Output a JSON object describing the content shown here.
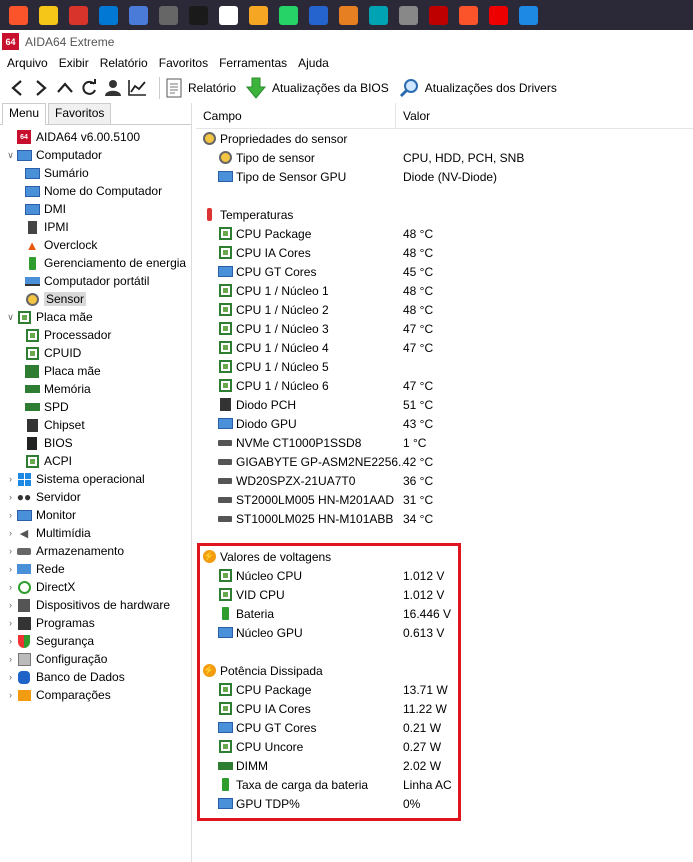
{
  "window": {
    "app_logo": "64",
    "title": "AIDA64 Extreme"
  },
  "menubar": [
    "Arquivo",
    "Exibir",
    "Relatório",
    "Favoritos",
    "Ferramentas",
    "Ajuda"
  ],
  "toolbar": {
    "report": "Relatório",
    "bios_updates": "Atualizações da BIOS",
    "driver_updates": "Atualizações dos Drivers"
  },
  "tabs": {
    "menu": "Menu",
    "favorites": "Favoritos"
  },
  "tree": [
    {
      "label": "AIDA64 v6.00.5100",
      "indent": 0,
      "exp": "",
      "icon": "aida-logo"
    },
    {
      "label": "Computador",
      "indent": 0,
      "exp": "v",
      "icon": "computer"
    },
    {
      "label": "Sumário",
      "indent": 1,
      "exp": "",
      "icon": "monitor"
    },
    {
      "label": "Nome do Computador",
      "indent": 1,
      "exp": "",
      "icon": "monitor"
    },
    {
      "label": "DMI",
      "indent": 1,
      "exp": "",
      "icon": "monitor"
    },
    {
      "label": "IPMI",
      "indent": 1,
      "exp": "",
      "icon": "server"
    },
    {
      "label": "Overclock",
      "indent": 1,
      "exp": "",
      "icon": "flame"
    },
    {
      "label": "Gerenciamento de energia",
      "indent": 1,
      "exp": "",
      "icon": "battery"
    },
    {
      "label": "Computador portátil",
      "indent": 1,
      "exp": "",
      "icon": "laptop"
    },
    {
      "label": "Sensor",
      "indent": 1,
      "exp": "",
      "icon": "gauge",
      "selected": true
    },
    {
      "label": "Placa mãe",
      "indent": 0,
      "exp": "v",
      "icon": "chip"
    },
    {
      "label": "Processador",
      "indent": 1,
      "exp": "",
      "icon": "chip"
    },
    {
      "label": "CPUID",
      "indent": 1,
      "exp": "",
      "icon": "chip"
    },
    {
      "label": "Placa mãe",
      "indent": 1,
      "exp": "",
      "icon": "board"
    },
    {
      "label": "Memória",
      "indent": 1,
      "exp": "",
      "icon": "ram"
    },
    {
      "label": "SPD",
      "indent": 1,
      "exp": "",
      "icon": "ram"
    },
    {
      "label": "Chipset",
      "indent": 1,
      "exp": "",
      "icon": "chipset"
    },
    {
      "label": "BIOS",
      "indent": 1,
      "exp": "",
      "icon": "bios"
    },
    {
      "label": "ACPI",
      "indent": 1,
      "exp": "",
      "icon": "chip"
    },
    {
      "label": "Sistema operacional",
      "indent": 0,
      "exp": ">",
      "icon": "windows"
    },
    {
      "label": "Servidor",
      "indent": 0,
      "exp": ">",
      "icon": "users"
    },
    {
      "label": "Monitor",
      "indent": 0,
      "exp": ">",
      "icon": "monitor"
    },
    {
      "label": "Multimídia",
      "indent": 0,
      "exp": ">",
      "icon": "speaker"
    },
    {
      "label": "Armazenamento",
      "indent": 0,
      "exp": ">",
      "icon": "storage"
    },
    {
      "label": "Rede",
      "indent": 0,
      "exp": ">",
      "icon": "network"
    },
    {
      "label": "DirectX",
      "indent": 0,
      "exp": ">",
      "icon": "directx"
    },
    {
      "label": "Dispositivos de hardware",
      "indent": 0,
      "exp": ">",
      "icon": "devices"
    },
    {
      "label": "Programas",
      "indent": 0,
      "exp": ">",
      "icon": "programs"
    },
    {
      "label": "Segurança",
      "indent": 0,
      "exp": ">",
      "icon": "shield"
    },
    {
      "label": "Configuração",
      "indent": 0,
      "exp": ">",
      "icon": "config"
    },
    {
      "label": "Banco de Dados",
      "indent": 0,
      "exp": ">",
      "icon": "database"
    },
    {
      "label": "Comparações",
      "indent": 0,
      "exp": ">",
      "icon": "compare"
    }
  ],
  "columns": {
    "field": "Campo",
    "value": "Valor"
  },
  "rows": [
    {
      "type": "group",
      "field": "Propriedades do sensor",
      "value": "",
      "icon": "gauge"
    },
    {
      "type": "item",
      "field": "Tipo de sensor",
      "value": "CPU, HDD, PCH, SNB",
      "icon": "gauge"
    },
    {
      "type": "item",
      "field": "Tipo de Sensor GPU",
      "value": "Diode  (NV-Diode)",
      "icon": "monitor"
    },
    {
      "type": "blank"
    },
    {
      "type": "group",
      "field": "Temperaturas",
      "value": "",
      "icon": "thermo"
    },
    {
      "type": "item",
      "field": "CPU Package",
      "value": "48 °C",
      "icon": "chip"
    },
    {
      "type": "item",
      "field": "CPU IA Cores",
      "value": "48 °C",
      "icon": "chip"
    },
    {
      "type": "item",
      "field": "CPU GT Cores",
      "value": "45 °C",
      "icon": "monitor"
    },
    {
      "type": "item",
      "field": "CPU 1 / Núcleo 1",
      "value": "48 °C",
      "icon": "chip"
    },
    {
      "type": "item",
      "field": "CPU 1 / Núcleo 2",
      "value": "48 °C",
      "icon": "chip"
    },
    {
      "type": "item",
      "field": "CPU 1 / Núcleo 3",
      "value": "47 °C",
      "icon": "chip"
    },
    {
      "type": "item",
      "field": "CPU 1 / Núcleo 4",
      "value": "47 °C",
      "icon": "chip"
    },
    {
      "type": "item",
      "field": "CPU 1 / Núcleo 5",
      "value": "",
      "icon": "chip"
    },
    {
      "type": "item",
      "field": "CPU 1 / Núcleo 6",
      "value": "47 °C",
      "icon": "chip"
    },
    {
      "type": "item",
      "field": "Diodo PCH",
      "value": "51 °C",
      "icon": "chipset"
    },
    {
      "type": "item",
      "field": "Diodo GPU",
      "value": "43 °C",
      "icon": "monitor"
    },
    {
      "type": "item",
      "field": "NVMe CT1000P1SSD8",
      "value": "1 °C",
      "icon": "disk"
    },
    {
      "type": "item",
      "field": "GIGABYTE GP-ASM2NE2256...",
      "value": "42 °C",
      "icon": "disk"
    },
    {
      "type": "item",
      "field": "WD20SPZX-21UA7T0",
      "value": "36 °C",
      "icon": "disk"
    },
    {
      "type": "item",
      "field": "ST2000LM005 HN-M201AAD",
      "value": "31 °C",
      "icon": "disk"
    },
    {
      "type": "item",
      "field": "ST1000LM025 HN-M101ABB",
      "value": "34 °C",
      "icon": "disk"
    },
    {
      "type": "blank"
    },
    {
      "type": "group",
      "field": "Valores de voltagens",
      "value": "",
      "icon": "bolt"
    },
    {
      "type": "item",
      "field": "Núcleo CPU",
      "value": "1.012 V",
      "icon": "chip"
    },
    {
      "type": "item",
      "field": "VID CPU",
      "value": "1.012 V",
      "icon": "chip"
    },
    {
      "type": "item",
      "field": "Bateria",
      "value": "16.446 V",
      "icon": "battery"
    },
    {
      "type": "item",
      "field": "Núcleo GPU",
      "value": "0.613 V",
      "icon": "monitor"
    },
    {
      "type": "blank"
    },
    {
      "type": "group",
      "field": "Potência Dissipada",
      "value": "",
      "icon": "bolt"
    },
    {
      "type": "item",
      "field": "CPU Package",
      "value": "13.71 W",
      "icon": "chip"
    },
    {
      "type": "item",
      "field": "CPU IA Cores",
      "value": "11.22 W",
      "icon": "chip"
    },
    {
      "type": "item",
      "field": "CPU GT Cores",
      "value": "0.21 W",
      "icon": "monitor"
    },
    {
      "type": "item",
      "field": "CPU Uncore",
      "value": "0.27 W",
      "icon": "chip"
    },
    {
      "type": "item",
      "field": "DIMM",
      "value": "2.02 W",
      "icon": "ram"
    },
    {
      "type": "item",
      "field": "Taxa de carga da bateria",
      "value": "Linha AC",
      "icon": "battery"
    },
    {
      "type": "item",
      "field": "GPU TDP%",
      "value": "0%",
      "icon": "monitor"
    }
  ],
  "taskbar_icons": [
    "brave",
    "file-explorer",
    "app-red",
    "microsoft-store",
    "app-circle",
    "calculator",
    "investing",
    "grammarly",
    "vlc",
    "whatsapp",
    "todo-check",
    "app-orange",
    "app-teal",
    "app-gray",
    "filezilla",
    "brave-lion",
    "opera",
    "app-bell"
  ]
}
